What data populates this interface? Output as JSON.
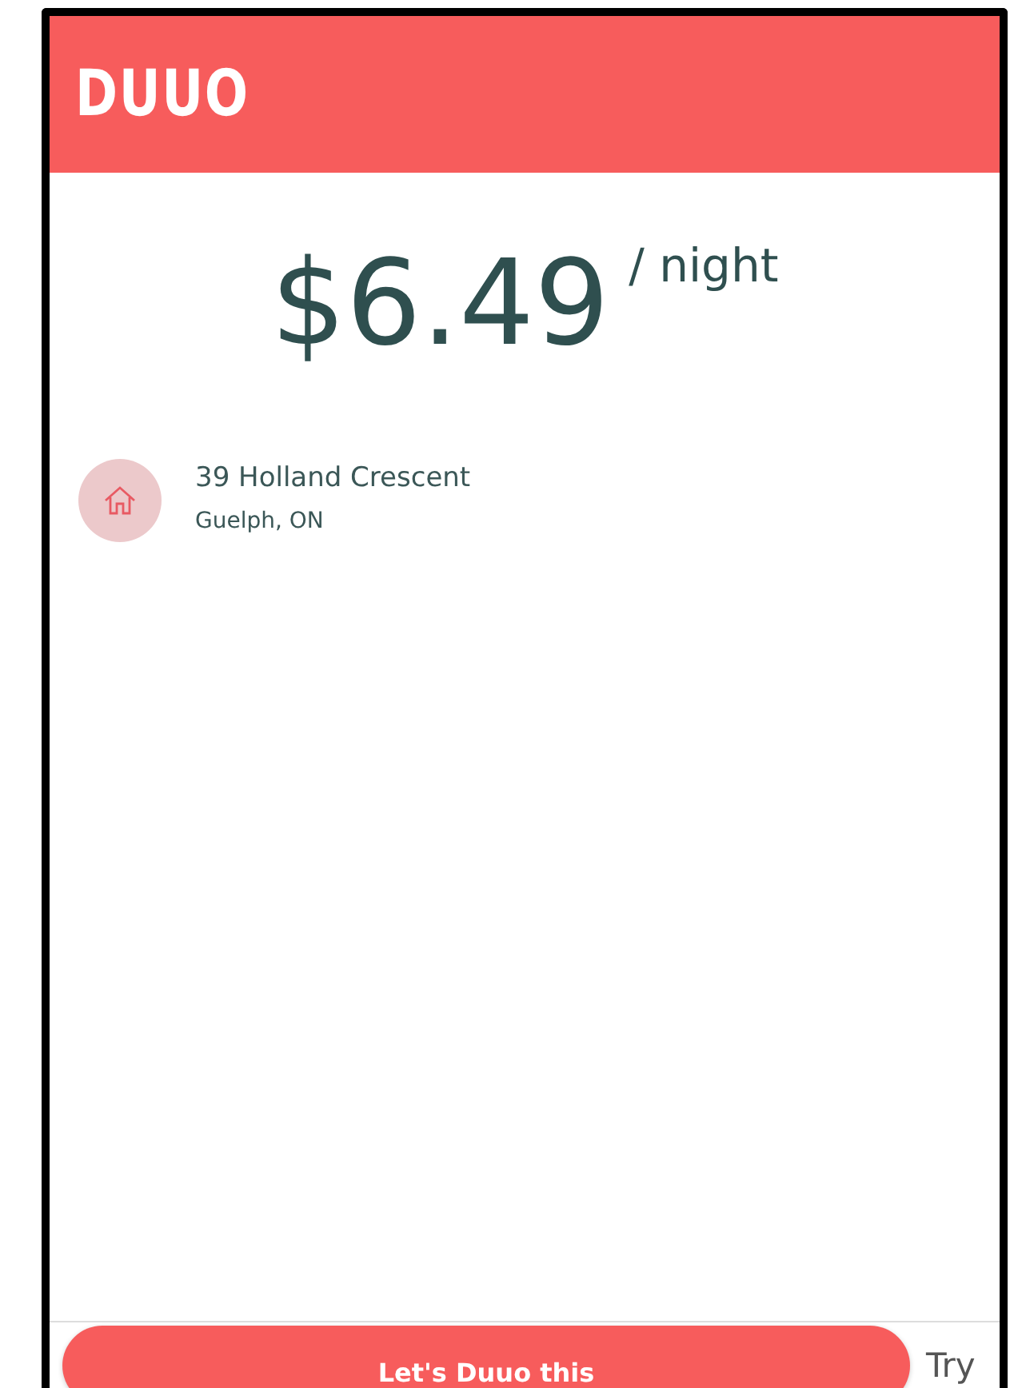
{
  "header": {
    "logo": "DUUO"
  },
  "price": {
    "amount": "$6.49",
    "unit": "/ night"
  },
  "location": {
    "street": "39 Holland Crescent",
    "city": "Guelph, ON"
  },
  "footer": {
    "primary_button": "Let's Duuo this",
    "secondary_button": "Try"
  }
}
